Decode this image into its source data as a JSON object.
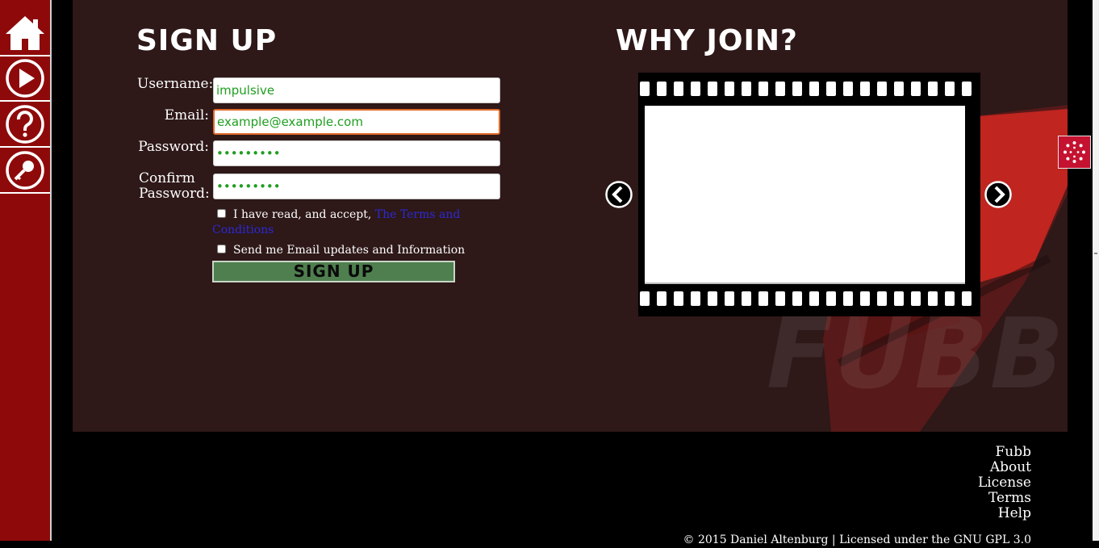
{
  "sidebar": {
    "items": [
      {
        "name": "home",
        "icon": "home-icon"
      },
      {
        "name": "play",
        "icon": "play-icon"
      },
      {
        "name": "help",
        "icon": "question-icon"
      },
      {
        "name": "login",
        "icon": "key-icon"
      }
    ]
  },
  "signup": {
    "title": "Sign Up",
    "username_label": "Username:",
    "username_value": "impulsive",
    "email_label": "Email:",
    "email_value": "example@example.com",
    "password_label": "Password:",
    "password_value": "•••••••••",
    "confirm_label_line1": "Confirm",
    "confirm_label_line2": "Password:",
    "confirm_value": "•••••••••",
    "terms_text": "I have read, and accept,",
    "terms_link": "The Terms and Conditions",
    "updates_text": "Send me Email updates and Information",
    "button_label": "Sign Up"
  },
  "why_join": {
    "title": "Why Join?",
    "prev_icon": "chevron-left-icon",
    "next_icon": "chevron-right-icon"
  },
  "watermark": "FUBB",
  "footer": {
    "links": [
      "Fubb",
      "About",
      "License",
      "Terms",
      "Help"
    ],
    "copyright": "© 2015 Daniel Altenburg | Licensed under the GNU GPL 3.0"
  },
  "colors": {
    "sidebar": "#8e0a0a",
    "panel": "#2e1818",
    "button": "#4f7f4f",
    "input_text": "#1f9e1f",
    "focus_border": "#e06a2a",
    "widget": "#c41230"
  }
}
